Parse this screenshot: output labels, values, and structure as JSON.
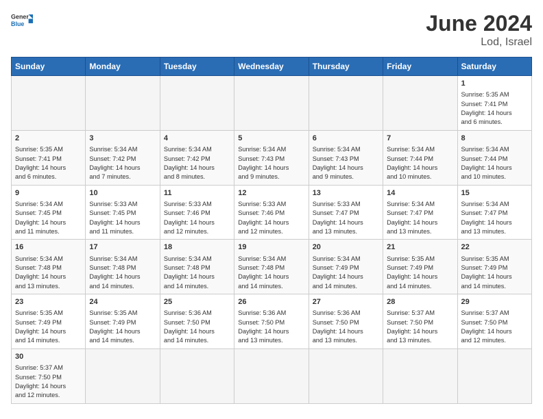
{
  "header": {
    "logo_general": "General",
    "logo_blue": "Blue",
    "title": "June 2024",
    "subtitle": "Lod, Israel"
  },
  "days_of_week": [
    "Sunday",
    "Monday",
    "Tuesday",
    "Wednesday",
    "Thursday",
    "Friday",
    "Saturday"
  ],
  "weeks": [
    [
      {
        "day": "",
        "content": ""
      },
      {
        "day": "",
        "content": ""
      },
      {
        "day": "",
        "content": ""
      },
      {
        "day": "",
        "content": ""
      },
      {
        "day": "",
        "content": ""
      },
      {
        "day": "",
        "content": ""
      },
      {
        "day": "1",
        "content": "Sunrise: 5:35 AM\nSunset: 7:41 PM\nDaylight: 14 hours\nand 6 minutes."
      }
    ],
    [
      {
        "day": "2",
        "content": "Sunrise: 5:35 AM\nSunset: 7:41 PM\nDaylight: 14 hours\nand 6 minutes."
      },
      {
        "day": "3",
        "content": "Sunrise: 5:34 AM\nSunset: 7:42 PM\nDaylight: 14 hours\nand 7 minutes."
      },
      {
        "day": "4",
        "content": "Sunrise: 5:34 AM\nSunset: 7:42 PM\nDaylight: 14 hours\nand 8 minutes."
      },
      {
        "day": "5",
        "content": "Sunrise: 5:34 AM\nSunset: 7:43 PM\nDaylight: 14 hours\nand 9 minutes."
      },
      {
        "day": "6",
        "content": "Sunrise: 5:34 AM\nSunset: 7:43 PM\nDaylight: 14 hours\nand 9 minutes."
      },
      {
        "day": "7",
        "content": "Sunrise: 5:34 AM\nSunset: 7:44 PM\nDaylight: 14 hours\nand 10 minutes."
      },
      {
        "day": "8",
        "content": "Sunrise: 5:34 AM\nSunset: 7:44 PM\nDaylight: 14 hours\nand 10 minutes."
      }
    ],
    [
      {
        "day": "9",
        "content": "Sunrise: 5:34 AM\nSunset: 7:45 PM\nDaylight: 14 hours\nand 11 minutes."
      },
      {
        "day": "10",
        "content": "Sunrise: 5:33 AM\nSunset: 7:45 PM\nDaylight: 14 hours\nand 11 minutes."
      },
      {
        "day": "11",
        "content": "Sunrise: 5:33 AM\nSunset: 7:46 PM\nDaylight: 14 hours\nand 12 minutes."
      },
      {
        "day": "12",
        "content": "Sunrise: 5:33 AM\nSunset: 7:46 PM\nDaylight: 14 hours\nand 12 minutes."
      },
      {
        "day": "13",
        "content": "Sunrise: 5:33 AM\nSunset: 7:47 PM\nDaylight: 14 hours\nand 13 minutes."
      },
      {
        "day": "14",
        "content": "Sunrise: 5:34 AM\nSunset: 7:47 PM\nDaylight: 14 hours\nand 13 minutes."
      },
      {
        "day": "15",
        "content": "Sunrise: 5:34 AM\nSunset: 7:47 PM\nDaylight: 14 hours\nand 13 minutes."
      }
    ],
    [
      {
        "day": "16",
        "content": "Sunrise: 5:34 AM\nSunset: 7:48 PM\nDaylight: 14 hours\nand 13 minutes."
      },
      {
        "day": "17",
        "content": "Sunrise: 5:34 AM\nSunset: 7:48 PM\nDaylight: 14 hours\nand 14 minutes."
      },
      {
        "day": "18",
        "content": "Sunrise: 5:34 AM\nSunset: 7:48 PM\nDaylight: 14 hours\nand 14 minutes."
      },
      {
        "day": "19",
        "content": "Sunrise: 5:34 AM\nSunset: 7:48 PM\nDaylight: 14 hours\nand 14 minutes."
      },
      {
        "day": "20",
        "content": "Sunrise: 5:34 AM\nSunset: 7:49 PM\nDaylight: 14 hours\nand 14 minutes."
      },
      {
        "day": "21",
        "content": "Sunrise: 5:35 AM\nSunset: 7:49 PM\nDaylight: 14 hours\nand 14 minutes."
      },
      {
        "day": "22",
        "content": "Sunrise: 5:35 AM\nSunset: 7:49 PM\nDaylight: 14 hours\nand 14 minutes."
      }
    ],
    [
      {
        "day": "23",
        "content": "Sunrise: 5:35 AM\nSunset: 7:49 PM\nDaylight: 14 hours\nand 14 minutes."
      },
      {
        "day": "24",
        "content": "Sunrise: 5:35 AM\nSunset: 7:49 PM\nDaylight: 14 hours\nand 14 minutes."
      },
      {
        "day": "25",
        "content": "Sunrise: 5:36 AM\nSunset: 7:50 PM\nDaylight: 14 hours\nand 14 minutes."
      },
      {
        "day": "26",
        "content": "Sunrise: 5:36 AM\nSunset: 7:50 PM\nDaylight: 14 hours\nand 13 minutes."
      },
      {
        "day": "27",
        "content": "Sunrise: 5:36 AM\nSunset: 7:50 PM\nDaylight: 14 hours\nand 13 minutes."
      },
      {
        "day": "28",
        "content": "Sunrise: 5:37 AM\nSunset: 7:50 PM\nDaylight: 14 hours\nand 13 minutes."
      },
      {
        "day": "29",
        "content": "Sunrise: 5:37 AM\nSunset: 7:50 PM\nDaylight: 14 hours\nand 12 minutes."
      }
    ],
    [
      {
        "day": "30",
        "content": "Sunrise: 5:37 AM\nSunset: 7:50 PM\nDaylight: 14 hours\nand 12 minutes."
      },
      {
        "day": "",
        "content": ""
      },
      {
        "day": "",
        "content": ""
      },
      {
        "day": "",
        "content": ""
      },
      {
        "day": "",
        "content": ""
      },
      {
        "day": "",
        "content": ""
      },
      {
        "day": "",
        "content": ""
      }
    ]
  ]
}
